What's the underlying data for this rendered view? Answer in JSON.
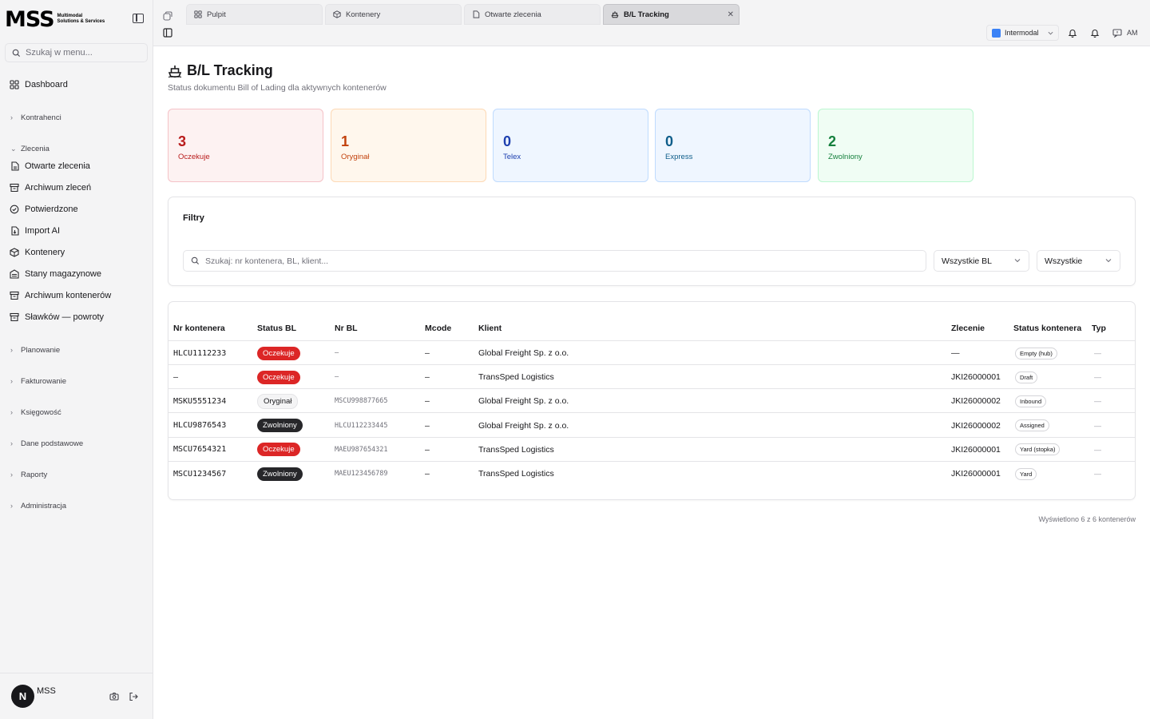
{
  "sidebar": {
    "logo_mark": "MSS",
    "logo_line1": "Multimodal",
    "logo_line2": "Solutions & Services",
    "search_placeholder": "Szukaj w menu...",
    "dashboard": "Dashboard",
    "groups": {
      "kontrahenci": "Kontrahenci",
      "zlecenia": "Zlecenia",
      "planowanie": "Planowanie",
      "fakturowanie": "Fakturowanie",
      "ksiegowosc": "Księgowość",
      "dane": "Dane podstawowe",
      "raporty": "Raporty",
      "administracja": "Administracja"
    },
    "items": [
      {
        "label": "Otwarte zlecenia",
        "icon": "file-icon"
      },
      {
        "label": "Archiwum zleceń",
        "icon": "archive-icon"
      },
      {
        "label": "Potwierdzone",
        "icon": "check-circle-icon"
      },
      {
        "label": "Import AI",
        "icon": "file-import-icon"
      },
      {
        "label": "Kontenery",
        "icon": "container-icon"
      },
      {
        "label": "Stany magazynowe",
        "icon": "warehouse-icon"
      },
      {
        "label": "Archiwum kontenerów",
        "icon": "archive-icon"
      },
      {
        "label": "Sławków — powroty",
        "icon": "archive-icon"
      }
    ],
    "user_name": "MSS",
    "avatar_letter": "N"
  },
  "tabs": [
    {
      "label": "Pulpit",
      "icon": "grid-icon"
    },
    {
      "label": "Kontenery",
      "icon": "container-icon"
    },
    {
      "label": "Otwarte zlecenia",
      "icon": "file-icon"
    },
    {
      "label": "B/L Tracking",
      "icon": "ship-icon"
    }
  ],
  "header": {
    "workspace": "Intermodal",
    "user_initials": "AM"
  },
  "page": {
    "title": "B/L Tracking",
    "subtitle": "Status dokumentu Bill of Lading dla aktywnych kontenerów"
  },
  "stats": [
    {
      "value": "3",
      "label": "Oczekuje",
      "bg": "#fdf2f2",
      "border": "#f5c2c7",
      "color": "#b91c1c"
    },
    {
      "value": "1",
      "label": "Oryginał",
      "bg": "#fff7ed",
      "border": "#fdd9b5",
      "color": "#c2410c"
    },
    {
      "value": "0",
      "label": "Telex",
      "bg": "#eff6ff",
      "border": "#bfdbfe",
      "color": "#1e40af"
    },
    {
      "value": "0",
      "label": "Express",
      "bg": "#eff6ff",
      "border": "#bfdbfe",
      "color": "#0e5d8a"
    },
    {
      "value": "2",
      "label": "Zwolniony",
      "bg": "#f0fdf4",
      "border": "#bbf7d0",
      "color": "#15803d"
    }
  ],
  "filters": {
    "title": "Filtry",
    "search_placeholder": "Szukaj: nr kontenera, BL, klient...",
    "bl_select": "Wszystkie BL",
    "type_select": "Wszystkie"
  },
  "table": {
    "headers": [
      "Nr kontenera",
      "Status BL",
      "Nr BL",
      "Mcode",
      "Klient",
      "Zlecenie",
      "Status kontenera",
      "Typ"
    ],
    "rows": [
      {
        "container": "HLCU1112233",
        "bl_status": "Oczekuje",
        "bl_variant": "red",
        "bl_no": "—",
        "mcode": "–",
        "client": "Global Freight Sp. z o.o.",
        "order": "—",
        "container_status": "Empty (hub)",
        "type": "—"
      },
      {
        "container": "–",
        "bl_status": "Oczekuje",
        "bl_variant": "red",
        "bl_no": "—",
        "mcode": "–",
        "client": "TransSped Logistics",
        "order": "JKI26000001",
        "container_status": "Draft",
        "type": "—"
      },
      {
        "container": "MSKU5551234",
        "bl_status": "Oryginał",
        "bl_variant": "gray",
        "bl_no": "MSCU998877665",
        "mcode": "–",
        "client": "Global Freight Sp. z o.o.",
        "order": "JKI26000002",
        "container_status": "Inbound",
        "type": "—"
      },
      {
        "container": "HLCU9876543",
        "bl_status": "Zwolniony",
        "bl_variant": "dark",
        "bl_no": "HLCU112233445",
        "mcode": "–",
        "client": "Global Freight Sp. z o.o.",
        "order": "JKI26000002",
        "container_status": "Assigned",
        "type": "—"
      },
      {
        "container": "MSCU7654321",
        "bl_status": "Oczekuje",
        "bl_variant": "red",
        "bl_no": "MAEU987654321",
        "mcode": "–",
        "client": "TransSped Logistics",
        "order": "JKI26000001",
        "container_status": "Yard (stopka)",
        "type": "—"
      },
      {
        "container": "MSCU1234567",
        "bl_status": "Zwolniony",
        "bl_variant": "dark",
        "bl_no": "MAEU123456789",
        "mcode": "–",
        "client": "TransSped Logistics",
        "order": "JKI26000001",
        "container_status": "Yard",
        "type": "—"
      }
    ]
  },
  "footer": {
    "count_text": "Wyświetlono 6 z 6 kontenerów"
  }
}
